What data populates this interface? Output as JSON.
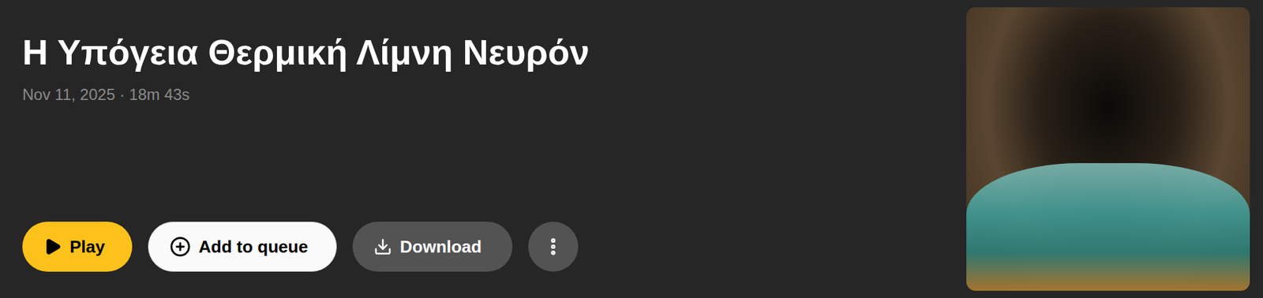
{
  "episode": {
    "title": "Η Υπόγεια Θερμική Λίμνη Νευρόν",
    "meta": "Nov 11, 2025 · 18m 43s"
  },
  "buttons": [
    {
      "label": "Play",
      "kind": "play"
    },
    {
      "label": "Add to queue",
      "kind": "queue"
    },
    {
      "label": "Download",
      "kind": "download"
    },
    {
      "label": "",
      "kind": "more"
    }
  ],
  "artwork": {
    "kind": "photo"
  }
}
